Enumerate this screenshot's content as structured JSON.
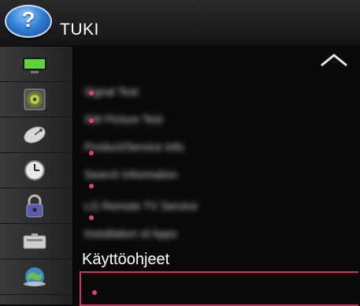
{
  "header": {
    "help_glyph": "?",
    "title": "TUKI"
  },
  "sidebar": {
    "items": [
      {
        "icon": "picture-icon"
      },
      {
        "icon": "speaker-icon"
      },
      {
        "icon": "satellite-dish-icon"
      },
      {
        "icon": "clock-icon"
      },
      {
        "icon": "lock-icon"
      },
      {
        "icon": "options-icon"
      },
      {
        "icon": "network-globe-icon"
      }
    ]
  },
  "main": {
    "scroll_up_icon": "chevron-up-icon",
    "items": [
      {
        "label": "Signal Test"
      },
      {
        "label": "SW Picture Test"
      },
      {
        "label": "Product/Service Info"
      },
      {
        "label": "Search Information"
      },
      {
        "label": "LG Remote TV Service"
      },
      {
        "label": "Installation of Apps"
      }
    ],
    "section_label": "Käyttöohjeet"
  },
  "colors": {
    "accent": "#d2325f",
    "dot": "#e0407a",
    "background": "#0b0b0b"
  }
}
